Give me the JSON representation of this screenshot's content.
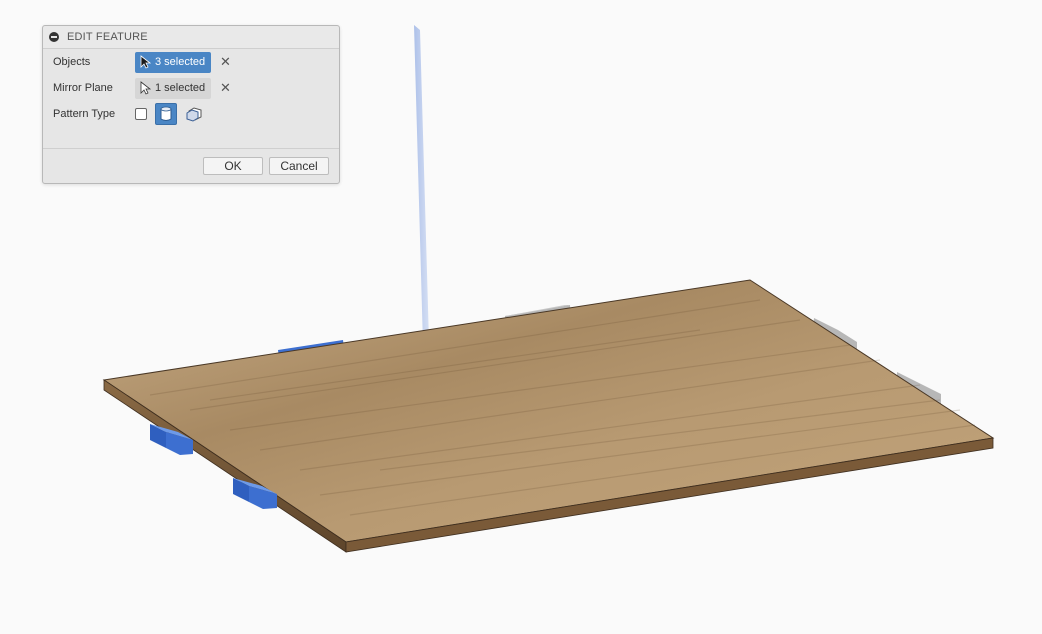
{
  "dialog": {
    "title": "EDIT FEATURE",
    "rows": [
      {
        "label": "Objects",
        "selection": "3 selected",
        "active": true
      },
      {
        "label": "Mirror Plane",
        "selection": "1 selected",
        "active": false
      }
    ],
    "pattern_type_label": "Pattern Type",
    "pattern_type_options": [
      "face-icon",
      "body-icon",
      "component-icon"
    ],
    "pattern_type_selected": "body-icon",
    "ok_label": "OK",
    "cancel_label": "Cancel"
  },
  "colors": {
    "accent": "#4a86c5",
    "selected_blue": "#3d6fd0",
    "wood": "#b08f66",
    "ghost_gray": "#a8a8a8",
    "mirror_plane": "#a7bce6"
  }
}
